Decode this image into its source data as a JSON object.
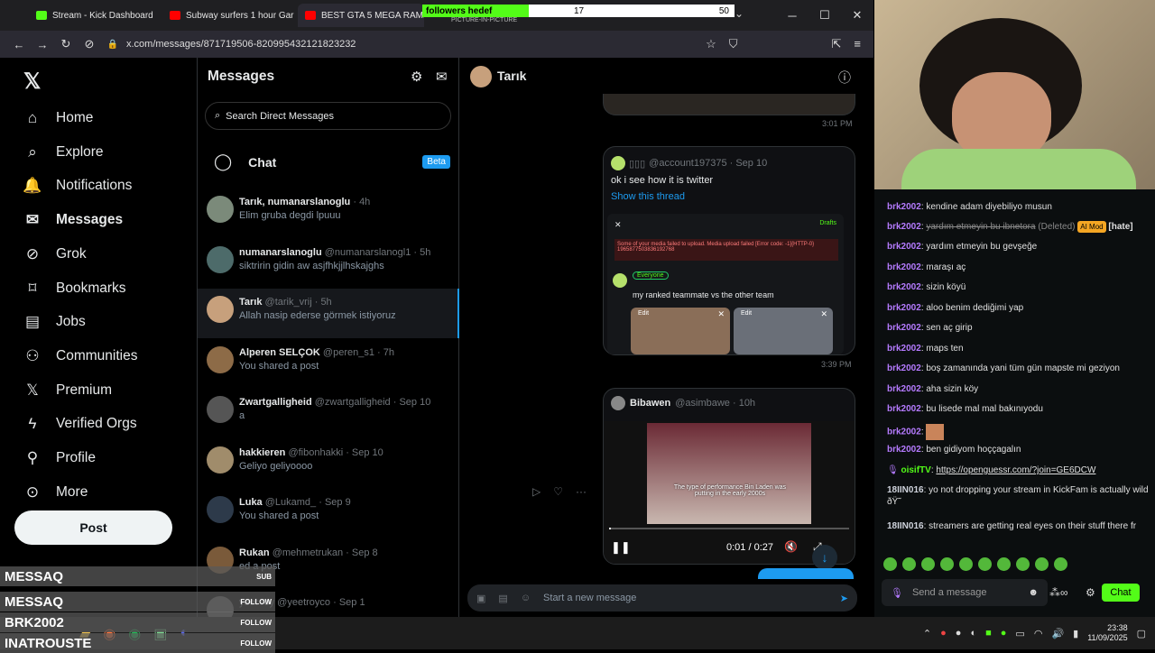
{
  "browser": {
    "tabs": [
      {
        "label": "Stream - Kick Dashboard",
        "color": "#53fc18"
      },
      {
        "label": "Subway surfers 1 hour Gar",
        "color": "#ff0000"
      },
      {
        "label": "BEST GTA 5 MEGA RAMP",
        "color": "#ff0000"
      }
    ],
    "url": "x.com/messages/871719506-820995432121823232",
    "pip_label": "PICTURE-IN-PICTURE"
  },
  "goal": {
    "label": "followers hedef",
    "current": "17",
    "target": "50",
    "progress": 0.34
  },
  "nav": {
    "items": [
      {
        "label": "Home",
        "icon": "home-icon"
      },
      {
        "label": "Explore",
        "icon": "search-icon"
      },
      {
        "label": "Notifications",
        "icon": "bell-icon"
      },
      {
        "label": "Messages",
        "icon": "mail-icon"
      },
      {
        "label": "Grok",
        "icon": "grok-icon"
      },
      {
        "label": "Bookmarks",
        "icon": "bookmark-icon"
      },
      {
        "label": "Jobs",
        "icon": "briefcase-icon"
      },
      {
        "label": "Communities",
        "icon": "people-icon"
      },
      {
        "label": "Premium",
        "icon": "x-logo-icon"
      },
      {
        "label": "Verified Orgs",
        "icon": "lightning-icon"
      },
      {
        "label": "Profile",
        "icon": "person-icon"
      },
      {
        "label": "More",
        "icon": "more-icon"
      }
    ],
    "post_label": "Post"
  },
  "messages": {
    "title": "Messages",
    "search_placeholder": "Search Direct Messages",
    "chat_label": "Chat",
    "beta_label": "Beta",
    "conversations": [
      {
        "name": "Tarık, numanarslanoglu",
        "handle": "· 4h",
        "last": "Elim gruba degdi lpuuu",
        "color": "#7b8a7a"
      },
      {
        "name": "numanarslanoglu",
        "handle": "@numanarslanogl1 · 5h",
        "last": "siktririn gidin aw asjfhkjjlhskajghs",
        "color": "#4d6b6a"
      },
      {
        "name": "Tarık",
        "handle": "@tarik_vrij · 5h",
        "last": "Allah nasip ederse görmek istiyoruz",
        "color": "#c7a07c"
      },
      {
        "name": "Alperen SELÇOK",
        "handle": "@peren_s1 · 7h",
        "last": "You shared a post",
        "color": "#8d6b47"
      },
      {
        "name": "Zwartgalligheid",
        "handle": "@zwartgalligheid · Sep 10",
        "last": "a",
        "color": "#555"
      },
      {
        "name": "hakkieren",
        "handle": "@fibonhakki · Sep 10",
        "last": "Geliyo geliyoooo",
        "color": "#a08c6b"
      },
      {
        "name": "Luka",
        "handle": "@Lukamd_ · Sep 9",
        "last": "You shared a post",
        "color": "#2d3a4a"
      },
      {
        "name": "Rukan",
        "handle": "@mehmetrukan · Sep 8",
        "last": "ed a post",
        "color": "#7a5a3a"
      },
      {
        "name": "",
        "handle": "yeet roy @yeetroyco · Sep 1",
        "last": "",
        "color": "#666"
      }
    ]
  },
  "conversation": {
    "name": "Tarık",
    "time1": "3:01 PM",
    "post1": {
      "handle": "@account197375 · Sep 10",
      "text": "ok i see how it is twitter",
      "thread_link": "Show this thread",
      "inner_error": "Some of your media failed to upload. Media upload failed [Error code: -1]{HTTP-0}",
      "inner_error2": "1965877503836192768",
      "drafts": "Drafts",
      "everyone": "Everyone",
      "caption": "my ranked teammate vs the other team",
      "edit": "Edit"
    },
    "time2": "3:39 PM",
    "post2": {
      "name": "Bibawen",
      "handle": "@asimbawe · 10h",
      "video_caption": "The type of performance Bin Laden was putting in the early 2000s",
      "video_time": "0:01 / 0:27"
    },
    "composer_placeholder": "Start a new message"
  },
  "chat": {
    "messages": [
      {
        "user": "brk2002",
        "text": "kendine adam diyebiliyo musun"
      },
      {
        "user": "brk2002",
        "text": "yardım etmeyin bu ibnetora",
        "deleted": "(Deleted)",
        "badge": "AI Mod",
        "tag": "[hate]"
      },
      {
        "user": "brk2002",
        "text": "yardım etmeyin bu gevşeğe"
      },
      {
        "user": "brk2002",
        "text": "maraşı aç"
      },
      {
        "user": "brk2002",
        "text": "sizin köyü"
      },
      {
        "user": "brk2002",
        "text": "aloo benim dediğimi yap"
      },
      {
        "user": "brk2002",
        "text": "sen aç girip"
      },
      {
        "user": "brk2002",
        "text": "maps ten"
      },
      {
        "user": "brk2002",
        "text": "boş zamanında yani tüm gün mapste mi geziyon"
      },
      {
        "user": "brk2002",
        "text": "aha sizin köy"
      },
      {
        "user": "brk2002",
        "text": "bu lisede mal mal bakınıyodu"
      },
      {
        "user": "brk2002",
        "text": ""
      },
      {
        "user": "brk2002",
        "text": "ben gidiyom hoççagalın"
      },
      {
        "user": "oisifTV",
        "text": "https://openguessr.com/?join=GE6DCW"
      },
      {
        "user": "18IIN016",
        "text": "yo not dropping your stream in KickFam is actually wild ðŸ˜"
      },
      {
        "user": "18IIN016",
        "text": "streamers are getting real eyes on their stuff there fr"
      }
    ],
    "input_placeholder": "Send a message",
    "send_label": "Chat"
  },
  "overlay": {
    "items": [
      {
        "name": "MESSAQ",
        "tag": "SUB"
      },
      {
        "name": "MESSAQ",
        "tag": "FOLLOW"
      },
      {
        "name": "BRK2002",
        "tag": "FOLLOW"
      },
      {
        "name": "INATROUSTE",
        "tag": "FOLLOW"
      }
    ]
  },
  "taskbar": {
    "time": "23:38",
    "date": "11/09/2025"
  }
}
